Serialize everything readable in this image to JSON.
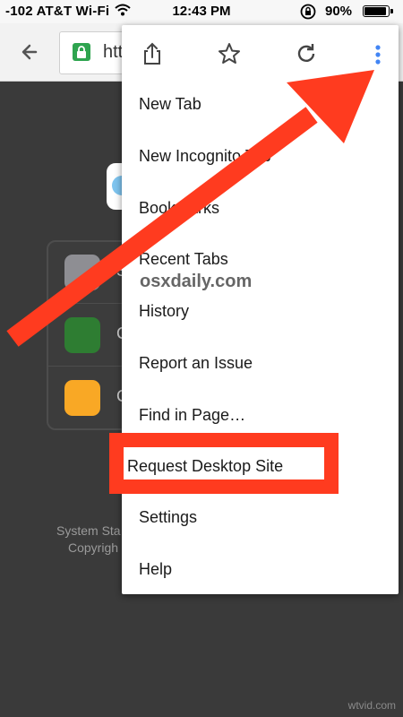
{
  "status_bar": {
    "carrier": "-102 AT&T Wi-Fi",
    "time": "12:43 PM",
    "battery": "90%"
  },
  "toolbar": {
    "url_partial": "htt"
  },
  "background": {
    "footer_line1": "System Sta",
    "footer_line2": "Copyrigh",
    "list_labels": [
      "S",
      "C",
      "C"
    ]
  },
  "menu": {
    "items": [
      "New Tab",
      "New Incognito Tab",
      "Bookmarks",
      "Recent Tabs",
      "History",
      "Report an Issue",
      "Find in Page…",
      "Request Desktop Site",
      "Settings",
      "Help"
    ]
  },
  "watermarks": {
    "overlay": "osxdaily.com",
    "corner": "wtvid.com"
  },
  "colors": {
    "highlight": "#ff3b1f",
    "arrow": "#ff3b1f",
    "more_dots": "#4285f4"
  },
  "icons": {
    "back": "back-arrow-icon",
    "lock": "lock-icon",
    "share": "share-icon",
    "bookmark_star": "star-icon",
    "reload": "reload-icon",
    "more": "more-vert-icon"
  }
}
